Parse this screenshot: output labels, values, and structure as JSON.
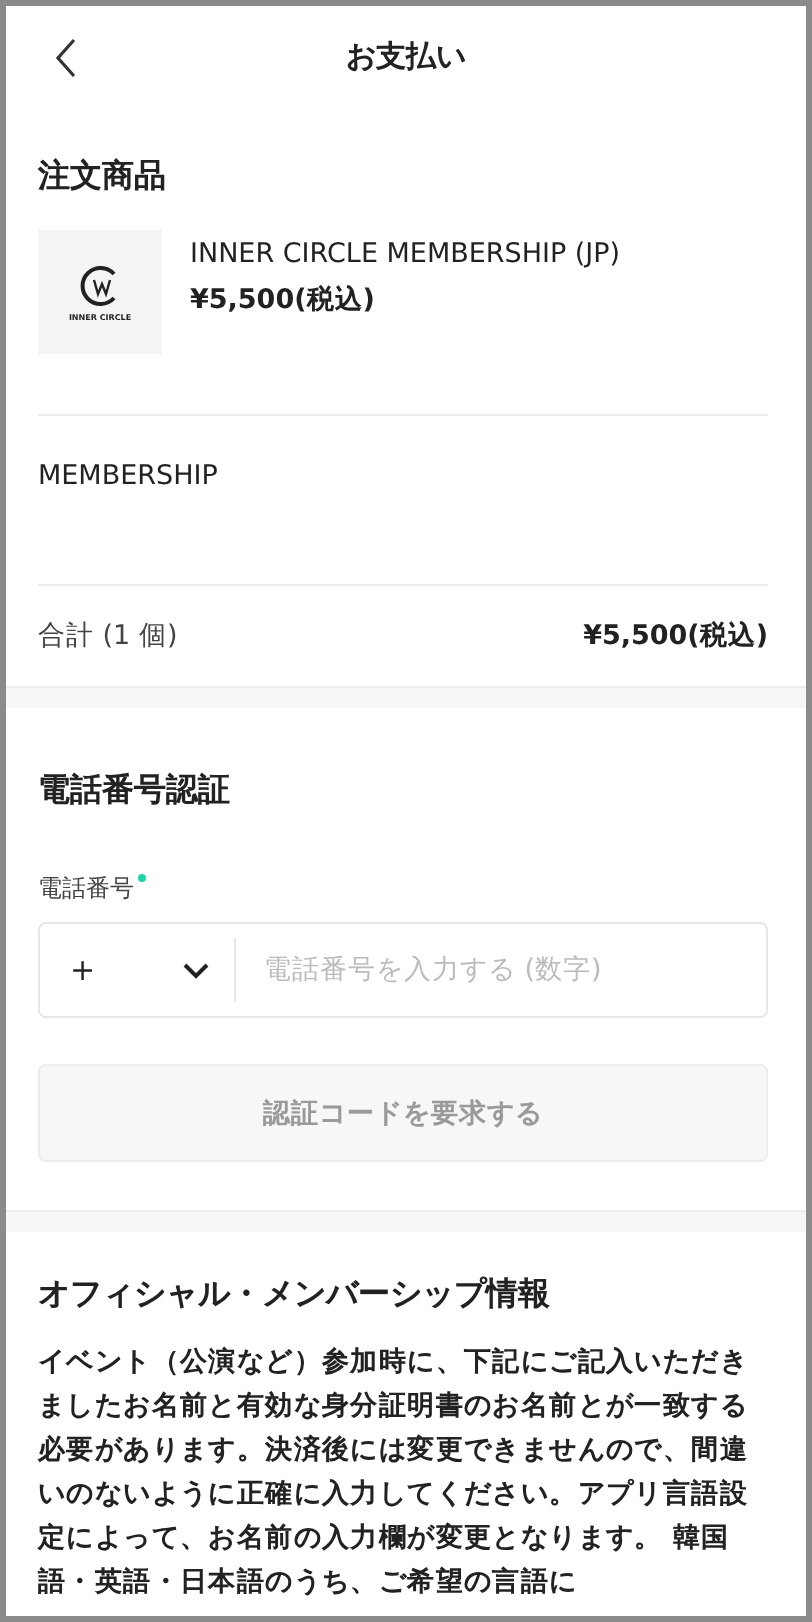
{
  "header": {
    "title": "お支払い"
  },
  "order": {
    "heading": "注文商品",
    "product": {
      "logo_text": "INNER CIRCLE",
      "name": "INNER CIRCLE MEMBERSHIP (JP)",
      "price": "¥5,500(税込)"
    },
    "option": "MEMBERSHIP",
    "total_label": "合計 (1 個)",
    "total_value": "¥5,500(税込)"
  },
  "phone": {
    "heading": "電話番号認証",
    "label": "電話番号",
    "required": true,
    "country_code": "+",
    "placeholder": "電話番号を入力する (数字)",
    "button": {
      "label": "認証コードを要求する",
      "disabled": true
    }
  },
  "info": {
    "heading": "オフィシャル・メンバーシップ情報",
    "text": "イベント（公演など）参加時に、下記にご記入いただきましたお名前と有効な身分証明書のお名前とが一致する必要があります。決済後には変更できませんので、間違いのないように正確に入力してください。アプリ言語設定によって、お名前の入力欄が変更となります。 韓国語・英語・日本語のうち、ご希望の言語に"
  }
}
